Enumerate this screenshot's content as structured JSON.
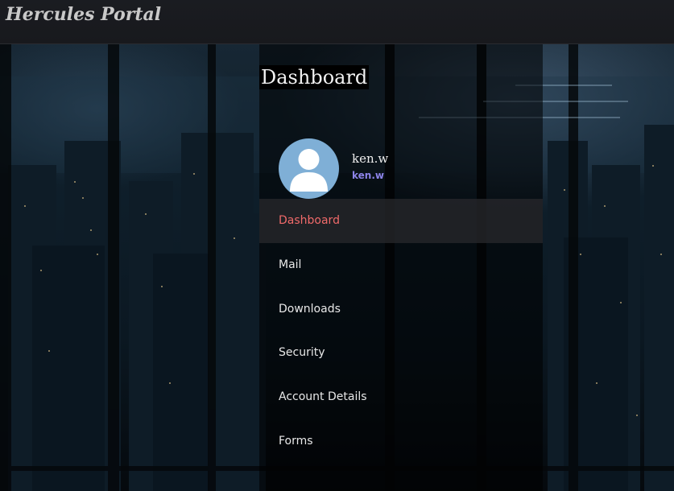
{
  "header": {
    "brand": "Hercules Portal"
  },
  "page": {
    "title": "Dashboard"
  },
  "user": {
    "name": "ken.w",
    "handle": "ken.w"
  },
  "menu": {
    "items": [
      {
        "label": "Dashboard",
        "active": true
      },
      {
        "label": "Mail",
        "active": false
      },
      {
        "label": "Downloads",
        "active": false
      },
      {
        "label": "Security",
        "active": false
      },
      {
        "label": "Account Details",
        "active": false
      },
      {
        "label": "Forms",
        "active": false
      }
    ]
  },
  "colors": {
    "active_item": "#f06a6a",
    "user_handle": "#8c83e8",
    "avatar_bg": "#7fafd6"
  },
  "icons": {
    "avatar": "user-silhouette-icon"
  }
}
